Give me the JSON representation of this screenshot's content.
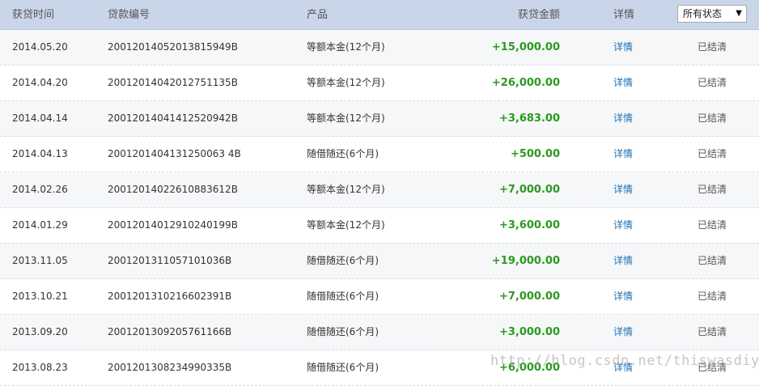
{
  "header": {
    "date": "获贷时间",
    "loan_id": "贷款编号",
    "product": "产品",
    "amount": "获贷金额",
    "detail": "详情",
    "status_filter": {
      "selected": "所有状态",
      "arrow": "▼"
    }
  },
  "rows": [
    {
      "date": "2014.05.20",
      "loan_id": "20012014052013815949B",
      "product": "等额本金(12个月)",
      "amount": "+15,000.00",
      "detail": "详情",
      "status": "已结清"
    },
    {
      "date": "2014.04.20",
      "loan_id": "20012014042012751135B",
      "product": "等额本金(12个月)",
      "amount": "+26,000.00",
      "detail": "详情",
      "status": "已结清"
    },
    {
      "date": "2014.04.14",
      "loan_id": "20012014041412520942B",
      "product": "等额本金(12个月)",
      "amount": "+3,683.00",
      "detail": "详情",
      "status": "已结清"
    },
    {
      "date": "2014.04.13",
      "loan_id": "2001201404131250063 4B",
      "product": "随借随还(6个月)",
      "amount": "+500.00",
      "detail": "详情",
      "status": "已结清"
    },
    {
      "date": "2014.02.26",
      "loan_id": "20012014022610883612B",
      "product": "等额本金(12个月)",
      "amount": "+7,000.00",
      "detail": "详情",
      "status": "已结清"
    },
    {
      "date": "2014.01.29",
      "loan_id": "20012014012910240199B",
      "product": "等额本金(12个月)",
      "amount": "+3,600.00",
      "detail": "详情",
      "status": "已结清"
    },
    {
      "date": "2013.11.05",
      "loan_id": "2001201311057101036B",
      "product": "随借随还(6个月)",
      "amount": "+19,000.00",
      "detail": "详情",
      "status": "已结清"
    },
    {
      "date": "2013.10.21",
      "loan_id": "2001201310216602391B",
      "product": "随借随还(6个月)",
      "amount": "+7,000.00",
      "detail": "详情",
      "status": "已结清"
    },
    {
      "date": "2013.09.20",
      "loan_id": "2001201309205761166B",
      "product": "随借随还(6个月)",
      "amount": "+3,000.00",
      "detail": "详情",
      "status": "已结清"
    },
    {
      "date": "2013.08.23",
      "loan_id": "2001201308234990335B",
      "product": "随借随还(6个月)",
      "amount": "+6,000.00",
      "detail": "详情",
      "status": "已结清"
    }
  ],
  "watermark": "http://blog.csdn.net/thiswasdiy",
  "colors": {
    "header_bg": "#c9d6ea",
    "amount_green": "#2a9a1f",
    "link_blue": "#1a6fb5"
  }
}
